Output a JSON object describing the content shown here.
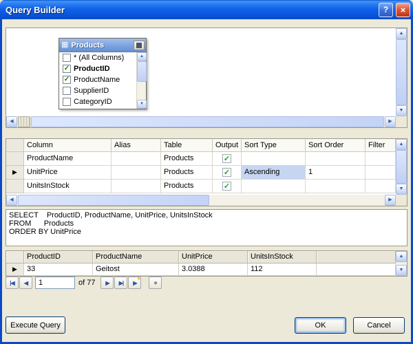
{
  "window": {
    "title": "Query Builder",
    "help_glyph": "?",
    "close_glyph": "×"
  },
  "icons": {
    "up": "▲",
    "down": "▼",
    "left": "◀",
    "right": "▶"
  },
  "diagram": {
    "table_card": {
      "title": "Products",
      "columns": [
        {
          "name": "* (All Columns)",
          "checked": false,
          "bold": false
        },
        {
          "name": "ProductID",
          "checked": true,
          "bold": true
        },
        {
          "name": "ProductName",
          "checked": true,
          "bold": false
        },
        {
          "name": "SupplierID",
          "checked": false,
          "bold": false
        },
        {
          "name": "CategoryID",
          "checked": false,
          "bold": false
        }
      ]
    }
  },
  "criteria_grid": {
    "headers": [
      "Column",
      "Alias",
      "Table",
      "Output",
      "Sort Type",
      "Sort Order",
      "Filter"
    ],
    "rows": [
      {
        "column": "ProductName",
        "alias": "",
        "table": "Products",
        "output": true,
        "sort_type": "",
        "sort_order": "",
        "current": false,
        "sort_type_selected": false
      },
      {
        "column": "UnitPrice",
        "alias": "",
        "table": "Products",
        "output": true,
        "sort_type": "Ascending",
        "sort_order": "1",
        "current": true,
        "sort_type_selected": true
      },
      {
        "column": "UnitsInStock",
        "alias": "",
        "table": "Products",
        "output": true,
        "sort_type": "",
        "sort_order": "",
        "current": false,
        "sort_type_selected": false
      }
    ]
  },
  "sql": {
    "text": "SELECT    ProductID, ProductName, UnitPrice, UnitsInStock\nFROM      Products\nORDER BY UnitPrice"
  },
  "results": {
    "headers": [
      "ProductID",
      "ProductName",
      "UnitPrice",
      "UnitsInStock"
    ],
    "rows": [
      {
        "cells": [
          "33",
          "Geitost",
          "3.0388",
          "112"
        ],
        "current": true
      }
    ]
  },
  "navigator": {
    "first": "|◀",
    "prev": "◀",
    "position": "1",
    "of_label": "of 77",
    "next": "▶",
    "last": "▶|",
    "new": "▶",
    "new_star": "*",
    "stop": "●"
  },
  "buttons": {
    "execute": "Execute Query",
    "ok": "OK",
    "cancel": "Cancel"
  }
}
